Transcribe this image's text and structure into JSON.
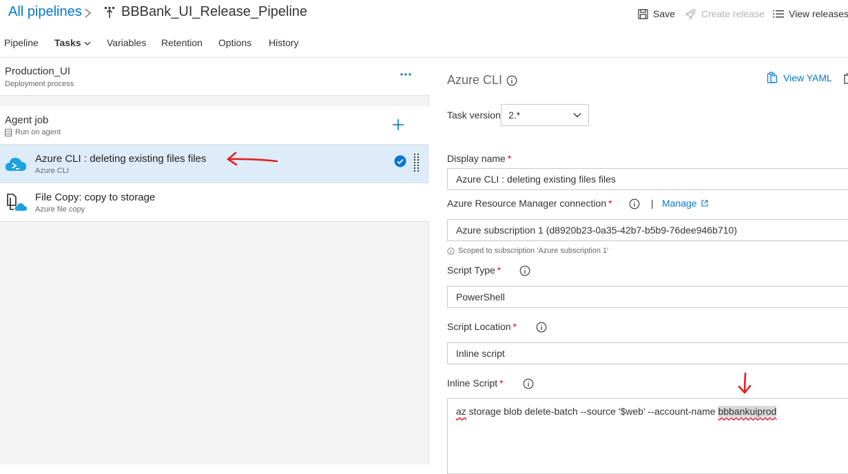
{
  "header": {
    "breadcrumb_root": "All pipelines",
    "pipeline_name": "BBBank_UI_Release_Pipeline",
    "save_label": "Save",
    "create_release_label": "Create release",
    "view_releases_label": "View releases"
  },
  "tabs": {
    "pipeline": "Pipeline",
    "tasks": "Tasks",
    "variables": "Variables",
    "retention": "Retention",
    "options": "Options",
    "history": "History",
    "active": "Tasks"
  },
  "stage": {
    "name": "Production_UI",
    "subtitle": "Deployment process"
  },
  "agent_job": {
    "name": "Agent job",
    "subtitle": "Run on agent"
  },
  "task_list": [
    {
      "name": "Azure CLI : deleting existing files files",
      "subtitle": "Azure CLI",
      "selected": true,
      "icon": "azure-cli-icon"
    },
    {
      "name": "File Copy: copy to storage",
      "subtitle": "Azure file copy",
      "selected": false,
      "icon": "file-copy-icon"
    }
  ],
  "task_detail": {
    "title": "Azure CLI",
    "view_yaml_label": "View YAML",
    "task_version_label": "Task version",
    "task_version_value": "2.*",
    "display_name_label": "Display name",
    "display_name_value": "Azure CLI : deleting existing files files",
    "arm_connection_label": "Azure Resource Manager connection",
    "manage_separator": "|",
    "manage_label": "Manage",
    "arm_connection_value": "Azure subscription 1 (d8920b23-0a35-42b7-b5b9-76dee946b710)",
    "scoped_note": "Scoped to subscription 'Azure subscription 1'",
    "script_type_label": "Script Type",
    "script_type_value": "PowerShell",
    "script_location_label": "Script Location",
    "script_location_value": "Inline script",
    "inline_script_label": "Inline Script",
    "inline_script_part1": "az",
    "inline_script_part2": " storage blob delete-batch --source '$web' --account-name ",
    "inline_script_part3": "bbbankuiprod",
    "required_mark": "*"
  },
  "colors": {
    "link": "#0078d4",
    "selected_row": "#deecf9",
    "annotation": "#e02020",
    "required": "#c50f1f"
  }
}
